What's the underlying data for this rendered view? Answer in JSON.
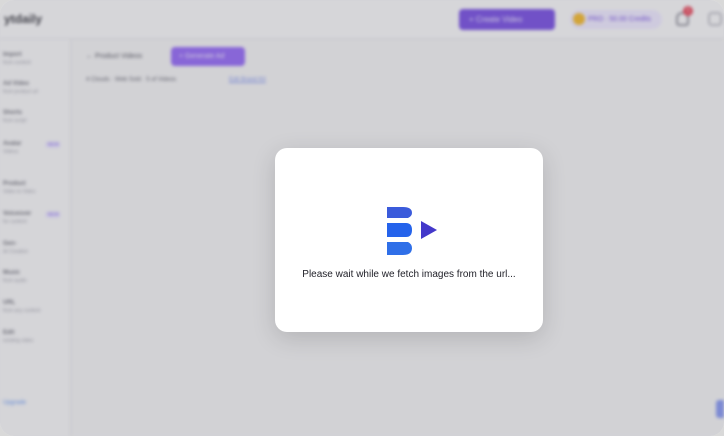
{
  "app": {
    "logo_text": "ytdaily"
  },
  "header": {
    "create_button_label": "+ Create Video",
    "plan_label": "PRO · 50.00 Credits",
    "notification_count": "1"
  },
  "sidebar": {
    "items": [
      {
        "title": "Import",
        "subtitle": "from content"
      },
      {
        "title": "Ad Video",
        "subtitle": "from product url",
        "badge": ""
      },
      {
        "title": "Shorts",
        "subtitle": "from script"
      },
      {
        "title": "Avatar",
        "subtitle": "Videos",
        "badge": "NEW"
      },
      {
        "title": "Product",
        "subtitle": "Video to Video"
      },
      {
        "title": "Voiceover",
        "subtitle": "for content",
        "badge": "NEW"
      },
      {
        "title": "Gen-",
        "subtitle": "AI Creation"
      },
      {
        "title": "Music",
        "subtitle": "from audio"
      },
      {
        "title": "URL",
        "subtitle": "from any content"
      },
      {
        "title": "Edit",
        "subtitle": "existing video"
      }
    ],
    "footer_label": "Upgrade"
  },
  "main": {
    "back_label": "← Product Videos",
    "tab_label": "+ Generate Ad",
    "stats_text": "4 Clouds · Web Sold · 5 of Videos",
    "stats_link": "Edit Brand Kit"
  },
  "modal": {
    "message": "Please wait while we fetch images from the url...",
    "colors": {
      "logo_blue": "#2563eb",
      "logo_indigo": "#4338ca"
    }
  }
}
